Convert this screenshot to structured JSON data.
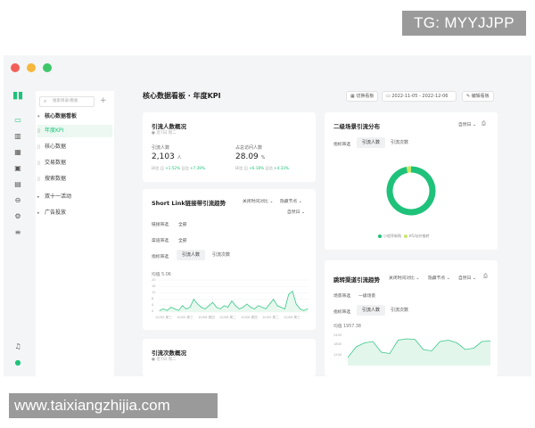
{
  "watermarks": {
    "top": "TG: MYYJJPP",
    "bottom": "www.taixiangzhijia.com"
  },
  "sidebar": {
    "search_placeholder": "搜索目录/看板",
    "items": [
      {
        "label": "核心数据看板",
        "type": "group",
        "expanded": true
      },
      {
        "label": "年度KPI",
        "type": "item",
        "active": true
      },
      {
        "label": "核心数据",
        "type": "item"
      },
      {
        "label": "交易数据",
        "type": "item"
      },
      {
        "label": "搜索数据",
        "type": "item"
      },
      {
        "label": "双十一活动",
        "type": "group",
        "expanded": false
      },
      {
        "label": "广告投放",
        "type": "group",
        "expanded": false
      }
    ]
  },
  "header": {
    "title": "核心数据看板 · 年度KPI",
    "toolbar_btn1": "切换看板",
    "date_start": "2022-11-05",
    "date_sep": "-",
    "date_end": "2022-12-06",
    "edit_btn": "编辑看板"
  },
  "card_overview": {
    "title": "引流人数概况",
    "subtitle": "● 近7日 周二",
    "kpis": [
      {
        "label": "引流人数",
        "value": "2,103",
        "unit": "人",
        "foot_a": "环比 日",
        "foot_a_val": "+1.52%",
        "foot_b": "日比",
        "foot_b_val": "+7.39%"
      },
      {
        "label": "占总访问人数",
        "value": "28.09",
        "unit": "%",
        "foot_a": "环比 日",
        "foot_a_val": "+6.18%",
        "foot_b": "日比",
        "foot_b_val": "+4.33%"
      }
    ]
  },
  "card_trend": {
    "title": "Short Link链接带引流趋势",
    "dropdown_a": "关闭时间对比",
    "dropdown_b": "隐藏节点",
    "dropdown_c": "自然日",
    "filter1_label": "链接筛选",
    "filter1_value": "全部",
    "filter2_label": "渠道筛选",
    "filter2_value": "全部",
    "metric_label": "指标筛选",
    "tab_on": "引流人数",
    "tab_off": "引流次数",
    "avg_label": "均值 5.06",
    "y_ticks": [
      "20",
      "16",
      "12",
      "8",
      "4",
      "0"
    ],
    "x_ticks": [
      "10/05 周三",
      "10/05 周三",
      "10/06 周四",
      "10/06 周二",
      "10/06 周四",
      "10/05 周二",
      "10/06 周三"
    ]
  },
  "card_count": {
    "title": "引流次数概况",
    "subtitle": "● 近7日 周二"
  },
  "card_donut": {
    "title": "二级场景引流分布",
    "dropdown": "自然日",
    "metric_label": "指标筛选",
    "tab_on": "引流人数",
    "tab_off": "引流次数",
    "legend_a": "小程序新购",
    "legend_b": "H5/站外推转",
    "accent": "#1ec27a",
    "accent2": "#c8e86a"
  },
  "card_channel": {
    "title": "跳转渠道引流趋势",
    "dropdown_a": "关闭时间对比",
    "dropdown_b": "隐藏节点",
    "dropdown_c": "自然日",
    "filter_label": "场景筛选",
    "filter_value": "一级场景",
    "metric_label": "指标筛选",
    "tab_on": "引流人数",
    "tab_off": "引流次数",
    "avg_label": "均值 1957.38",
    "y_ticks": [
      "2400",
      "1800",
      "1200"
    ]
  },
  "chart_data": [
    {
      "type": "line",
      "title": "Short Link链接带引流趋势",
      "ylim": [
        0,
        20
      ],
      "values": [
        1,
        2,
        1,
        3,
        2,
        1,
        4,
        2,
        3,
        8,
        5,
        3,
        2,
        4,
        6,
        3,
        2,
        4,
        3,
        7,
        4,
        2,
        3,
        5,
        3,
        2,
        4,
        3,
        2,
        5,
        8,
        4,
        3,
        2,
        11,
        13,
        5,
        2,
        1,
        2
      ]
    },
    {
      "type": "pie",
      "title": "二级场景引流分布",
      "categories": [
        "小程序新购",
        "H5/站外推转"
      ],
      "values": [
        97,
        3
      ]
    },
    {
      "type": "area",
      "title": "跳转渠道引流趋势",
      "ylim": [
        1200,
        2400
      ],
      "values": [
        1500,
        1900,
        2050,
        2100,
        1700,
        1650,
        2150,
        2200,
        2180,
        1800,
        1750,
        2100,
        2150,
        2050,
        1800,
        1850,
        2100,
        2120
      ]
    }
  ]
}
